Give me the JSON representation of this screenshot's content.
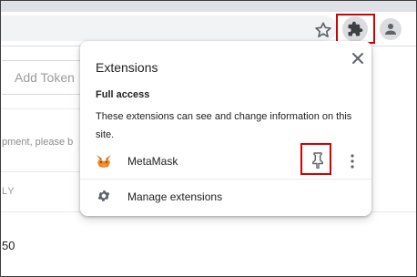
{
  "page": {
    "add_token_label": "Add Token",
    "info_text_fragment": "pment, please b",
    "column_fragment": "LY",
    "row_value_fragment": "50"
  },
  "toolbar": {
    "icons": [
      "star-icon",
      "puzzle-piece-icon",
      "profile-icon"
    ]
  },
  "extensions_popup": {
    "title": "Extensions",
    "close_icon": "close-icon",
    "section_title": "Full access",
    "section_desc": "These extensions can see and change information on this site.",
    "extensions": [
      {
        "name": "MetaMask",
        "icon": "metamask-fox-icon"
      }
    ],
    "manage_label": "Manage extensions"
  },
  "colors": {
    "highlight": "#d40000",
    "chrome_bg": "#dee1e6",
    "metamask_orange": "#e2761b"
  }
}
